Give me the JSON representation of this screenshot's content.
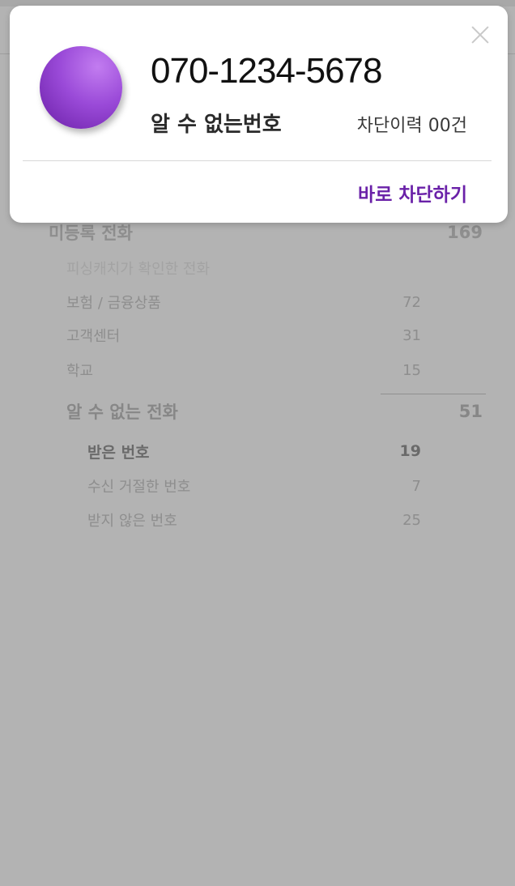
{
  "popup": {
    "phone_number": "070-1234-5678",
    "caller_type": "알 수 없는번호",
    "block_history": "차단이력 00건",
    "block_now_label": "바로 차단하기",
    "close_icon": "close-icon"
  },
  "list": {
    "unregistered": {
      "label": "미등록 전화",
      "count": "169"
    },
    "confirmed_header": "피싱캐치가 확인한 전화",
    "categories": [
      {
        "label": "보험 / 금융상품",
        "count": "72"
      },
      {
        "label": "고객센터",
        "count": "31"
      },
      {
        "label": "학교",
        "count": "15"
      }
    ],
    "unknown": {
      "label": "알 수 없는 전화",
      "count": "51",
      "children": [
        {
          "label": "받은 번호",
          "count": "19"
        },
        {
          "label": "수신 거절한 번호",
          "count": "7"
        },
        {
          "label": "받지 않은 번호",
          "count": "25"
        }
      ]
    }
  },
  "colors": {
    "accent": "#6a21a8",
    "overlay": "#b3b3b3"
  }
}
